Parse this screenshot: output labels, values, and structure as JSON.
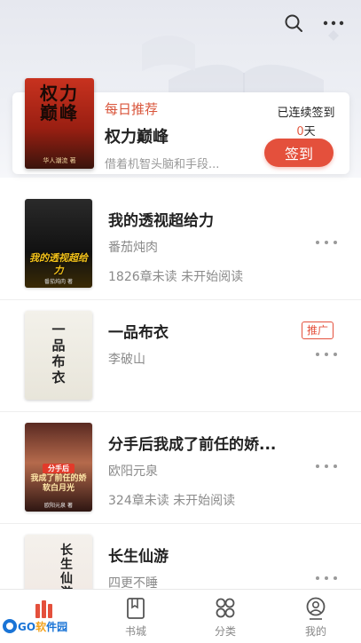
{
  "header": {
    "search_icon": "search-icon",
    "more_icon": "more-icon"
  },
  "recommend": {
    "tag": "每日推荐",
    "book_title": "权力巅峰",
    "description": "借着机智头脑和手段...",
    "cover_title": "权力巅峰",
    "cover_author": "华人潮流 著",
    "signin_label": "已连续签到",
    "signin_days": "0",
    "signin_unit": "天",
    "signin_button": "签到"
  },
  "books": [
    {
      "title": "我的透视超给力",
      "author": "番茄炖肉",
      "progress": "1826章未读 未开始阅读",
      "cover_text": "我的透视超给力",
      "cover_sub": "番茄炖肉 著",
      "promo": ""
    },
    {
      "title": "一品布衣",
      "author": "李破山",
      "progress": "",
      "cover_text": "一品布衣",
      "cover_sub": "",
      "promo": "推广"
    },
    {
      "title": "分手后我成了前任的娇...",
      "author": "欧阳元泉",
      "progress": "324章未读 未开始阅读",
      "cover_text": "我成了前任的娇软白月光",
      "cover_badge": "分手后",
      "cover_sub": "欧阳元泉 著",
      "promo": ""
    },
    {
      "title": "长生仙游",
      "author": "四更不睡",
      "progress": "",
      "cover_text": "长生仙游",
      "cover_sub": "",
      "promo": ""
    }
  ],
  "tabs": [
    {
      "label": "",
      "icon": "bookshelf-icon",
      "active": true
    },
    {
      "label": "书城",
      "icon": "bookstore-icon"
    },
    {
      "label": "分类",
      "icon": "category-icon"
    },
    {
      "label": "我的",
      "icon": "profile-icon"
    }
  ],
  "watermark": {
    "text_a": "GO",
    "text_b": "软",
    "text_c": "件园"
  },
  "colors": {
    "accent": "#e4503c",
    "header_bg": "#e6e8ef",
    "text_secondary": "#8a8a8a"
  }
}
